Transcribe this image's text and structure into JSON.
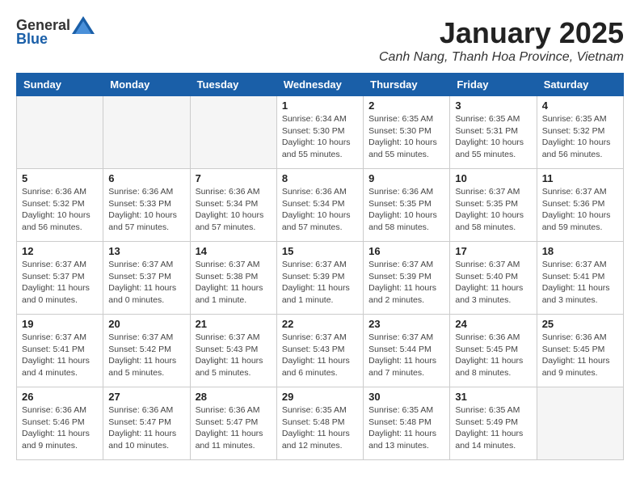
{
  "logo": {
    "general": "General",
    "blue": "Blue"
  },
  "title": "January 2025",
  "location": "Canh Nang, Thanh Hoa Province, Vietnam",
  "weekdays": [
    "Sunday",
    "Monday",
    "Tuesday",
    "Wednesday",
    "Thursday",
    "Friday",
    "Saturday"
  ],
  "weeks": [
    [
      {
        "day": "",
        "info": ""
      },
      {
        "day": "",
        "info": ""
      },
      {
        "day": "",
        "info": ""
      },
      {
        "day": "1",
        "info": "Sunrise: 6:34 AM\nSunset: 5:30 PM\nDaylight: 10 hours\nand 55 minutes."
      },
      {
        "day": "2",
        "info": "Sunrise: 6:35 AM\nSunset: 5:30 PM\nDaylight: 10 hours\nand 55 minutes."
      },
      {
        "day": "3",
        "info": "Sunrise: 6:35 AM\nSunset: 5:31 PM\nDaylight: 10 hours\nand 55 minutes."
      },
      {
        "day": "4",
        "info": "Sunrise: 6:35 AM\nSunset: 5:32 PM\nDaylight: 10 hours\nand 56 minutes."
      }
    ],
    [
      {
        "day": "5",
        "info": "Sunrise: 6:36 AM\nSunset: 5:32 PM\nDaylight: 10 hours\nand 56 minutes."
      },
      {
        "day": "6",
        "info": "Sunrise: 6:36 AM\nSunset: 5:33 PM\nDaylight: 10 hours\nand 57 minutes."
      },
      {
        "day": "7",
        "info": "Sunrise: 6:36 AM\nSunset: 5:34 PM\nDaylight: 10 hours\nand 57 minutes."
      },
      {
        "day": "8",
        "info": "Sunrise: 6:36 AM\nSunset: 5:34 PM\nDaylight: 10 hours\nand 57 minutes."
      },
      {
        "day": "9",
        "info": "Sunrise: 6:36 AM\nSunset: 5:35 PM\nDaylight: 10 hours\nand 58 minutes."
      },
      {
        "day": "10",
        "info": "Sunrise: 6:37 AM\nSunset: 5:35 PM\nDaylight: 10 hours\nand 58 minutes."
      },
      {
        "day": "11",
        "info": "Sunrise: 6:37 AM\nSunset: 5:36 PM\nDaylight: 10 hours\nand 59 minutes."
      }
    ],
    [
      {
        "day": "12",
        "info": "Sunrise: 6:37 AM\nSunset: 5:37 PM\nDaylight: 11 hours\nand 0 minutes."
      },
      {
        "day": "13",
        "info": "Sunrise: 6:37 AM\nSunset: 5:37 PM\nDaylight: 11 hours\nand 0 minutes."
      },
      {
        "day": "14",
        "info": "Sunrise: 6:37 AM\nSunset: 5:38 PM\nDaylight: 11 hours\nand 1 minute."
      },
      {
        "day": "15",
        "info": "Sunrise: 6:37 AM\nSunset: 5:39 PM\nDaylight: 11 hours\nand 1 minute."
      },
      {
        "day": "16",
        "info": "Sunrise: 6:37 AM\nSunset: 5:39 PM\nDaylight: 11 hours\nand 2 minutes."
      },
      {
        "day": "17",
        "info": "Sunrise: 6:37 AM\nSunset: 5:40 PM\nDaylight: 11 hours\nand 3 minutes."
      },
      {
        "day": "18",
        "info": "Sunrise: 6:37 AM\nSunset: 5:41 PM\nDaylight: 11 hours\nand 3 minutes."
      }
    ],
    [
      {
        "day": "19",
        "info": "Sunrise: 6:37 AM\nSunset: 5:41 PM\nDaylight: 11 hours\nand 4 minutes."
      },
      {
        "day": "20",
        "info": "Sunrise: 6:37 AM\nSunset: 5:42 PM\nDaylight: 11 hours\nand 5 minutes."
      },
      {
        "day": "21",
        "info": "Sunrise: 6:37 AM\nSunset: 5:43 PM\nDaylight: 11 hours\nand 5 minutes."
      },
      {
        "day": "22",
        "info": "Sunrise: 6:37 AM\nSunset: 5:43 PM\nDaylight: 11 hours\nand 6 minutes."
      },
      {
        "day": "23",
        "info": "Sunrise: 6:37 AM\nSunset: 5:44 PM\nDaylight: 11 hours\nand 7 minutes."
      },
      {
        "day": "24",
        "info": "Sunrise: 6:36 AM\nSunset: 5:45 PM\nDaylight: 11 hours\nand 8 minutes."
      },
      {
        "day": "25",
        "info": "Sunrise: 6:36 AM\nSunset: 5:45 PM\nDaylight: 11 hours\nand 9 minutes."
      }
    ],
    [
      {
        "day": "26",
        "info": "Sunrise: 6:36 AM\nSunset: 5:46 PM\nDaylight: 11 hours\nand 9 minutes."
      },
      {
        "day": "27",
        "info": "Sunrise: 6:36 AM\nSunset: 5:47 PM\nDaylight: 11 hours\nand 10 minutes."
      },
      {
        "day": "28",
        "info": "Sunrise: 6:36 AM\nSunset: 5:47 PM\nDaylight: 11 hours\nand 11 minutes."
      },
      {
        "day": "29",
        "info": "Sunrise: 6:35 AM\nSunset: 5:48 PM\nDaylight: 11 hours\nand 12 minutes."
      },
      {
        "day": "30",
        "info": "Sunrise: 6:35 AM\nSunset: 5:48 PM\nDaylight: 11 hours\nand 13 minutes."
      },
      {
        "day": "31",
        "info": "Sunrise: 6:35 AM\nSunset: 5:49 PM\nDaylight: 11 hours\nand 14 minutes."
      },
      {
        "day": "",
        "info": ""
      }
    ]
  ]
}
